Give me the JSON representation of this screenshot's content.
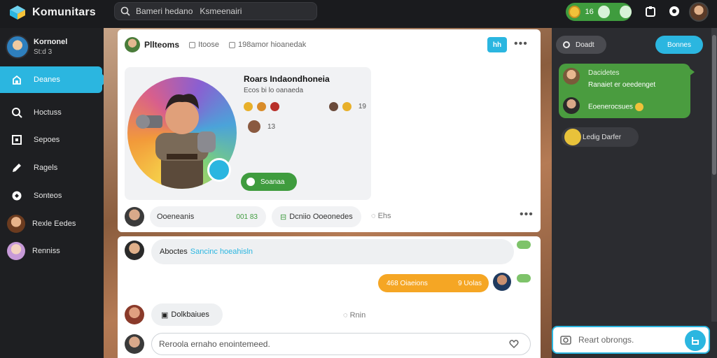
{
  "app": {
    "name": "Komunitars"
  },
  "search": {
    "placeholder": "Bameri hedano   Ksmeenairi"
  },
  "topbar": {
    "coin_count": "16",
    "coin_icon": "coin-icon",
    "notification_icon": "bell-icon",
    "settings_icon": "gear-icon"
  },
  "user": {
    "name": "Kornonel",
    "status": "St:d 3"
  },
  "sidebar": {
    "items": [
      {
        "label": "Deanes",
        "icon": "home-icon",
        "active": true
      },
      {
        "label": "Hoctuss",
        "icon": "search-icon"
      },
      {
        "label": "Sepoes",
        "icon": "square-icon"
      },
      {
        "label": "Ragels",
        "icon": "pen-icon"
      },
      {
        "label": "Sonteos",
        "icon": "globe-icon"
      },
      {
        "label": "Rexle Eedes",
        "icon": "avatar"
      },
      {
        "label": "Renniss",
        "icon": "avatar"
      }
    ]
  },
  "post": {
    "title": "Pllteoms",
    "meta1": "Itoose",
    "meta2": "198amor hioanedak",
    "badge": "hh",
    "inner_title": "Roars Indaondhoneia",
    "inner_subtitle": "Ecos bi lo oanaeda",
    "reaction_count": "19",
    "stat_count": "13",
    "green_button": "Soanaa",
    "footer_label": "Ooeneanis",
    "footer_count": "001 83",
    "footer_link": "Dcniio Ooeonedes",
    "footer_text": "Ehs"
  },
  "comments": {
    "first": {
      "label": "Aboctes",
      "highlight": "Sancinc hoeahisln"
    },
    "orange": {
      "text": "468 Oiaeions",
      "value": "9 Uolas"
    },
    "second": {
      "label": "Dolkbaiues"
    },
    "reply_text": "Rnin",
    "compose_placeholder": "Reroola ernaho enointemeed."
  },
  "right_panel": {
    "button_left": "Doadt",
    "button_right": "Bonnes",
    "chat_green": {
      "line1": "Dacidetes",
      "line2": "Ranaiet er oeedenget",
      "line3": "Eoenerocsues"
    },
    "chat_grey": "Ledig Darfer",
    "input_placeholder": "Reart obrongs."
  },
  "colors": {
    "accent": "#2bb6e0",
    "green": "#3f9c3e",
    "orange": "#f5a624"
  }
}
